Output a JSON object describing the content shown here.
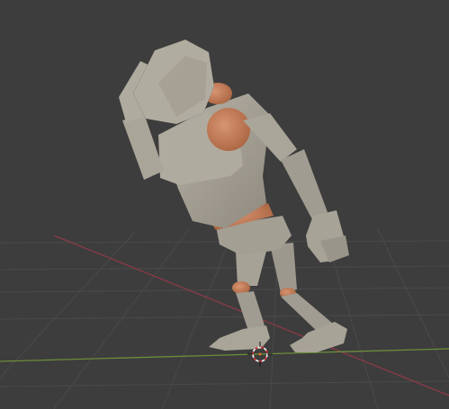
{
  "viewport": {
    "type": "3d-viewport",
    "background": "#3d3d3d",
    "grid_color": "#4a4a4a",
    "x_axis_color": "#8b3a46",
    "y_axis_color": "#6b8e3a",
    "mesh_color": "#a9a498",
    "mesh_shadow": "#8f8a7f",
    "skin_color": "#c9825e",
    "cursor_icon": "3d-cursor-icon"
  }
}
